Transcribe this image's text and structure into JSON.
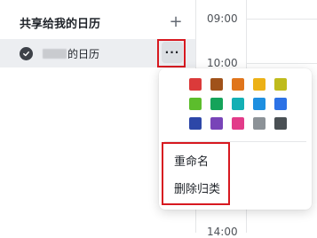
{
  "sidebar": {
    "section_title": "共享给我的日历",
    "add_icon": "plus-icon",
    "calendar": {
      "name_suffix": "的日历",
      "checked": true,
      "more_label": "···"
    }
  },
  "timeline": {
    "hours": [
      "09:00",
      "10:00",
      "14:00"
    ]
  },
  "color_menu": {
    "colors": [
      "#db3a3a",
      "#a0521a",
      "#e0751c",
      "#ecb116",
      "#bfbb1c",
      "#5cbd2c",
      "#15a35a",
      "#13afb4",
      "#1e8fe0",
      "#2c72e6",
      "#2d47a8",
      "#7844b8",
      "#e23b89",
      "#8c9297",
      "#4a5054"
    ],
    "items": [
      {
        "label": "重命名"
      },
      {
        "label": "删除归类"
      }
    ]
  },
  "highlight_color": "#d71920"
}
